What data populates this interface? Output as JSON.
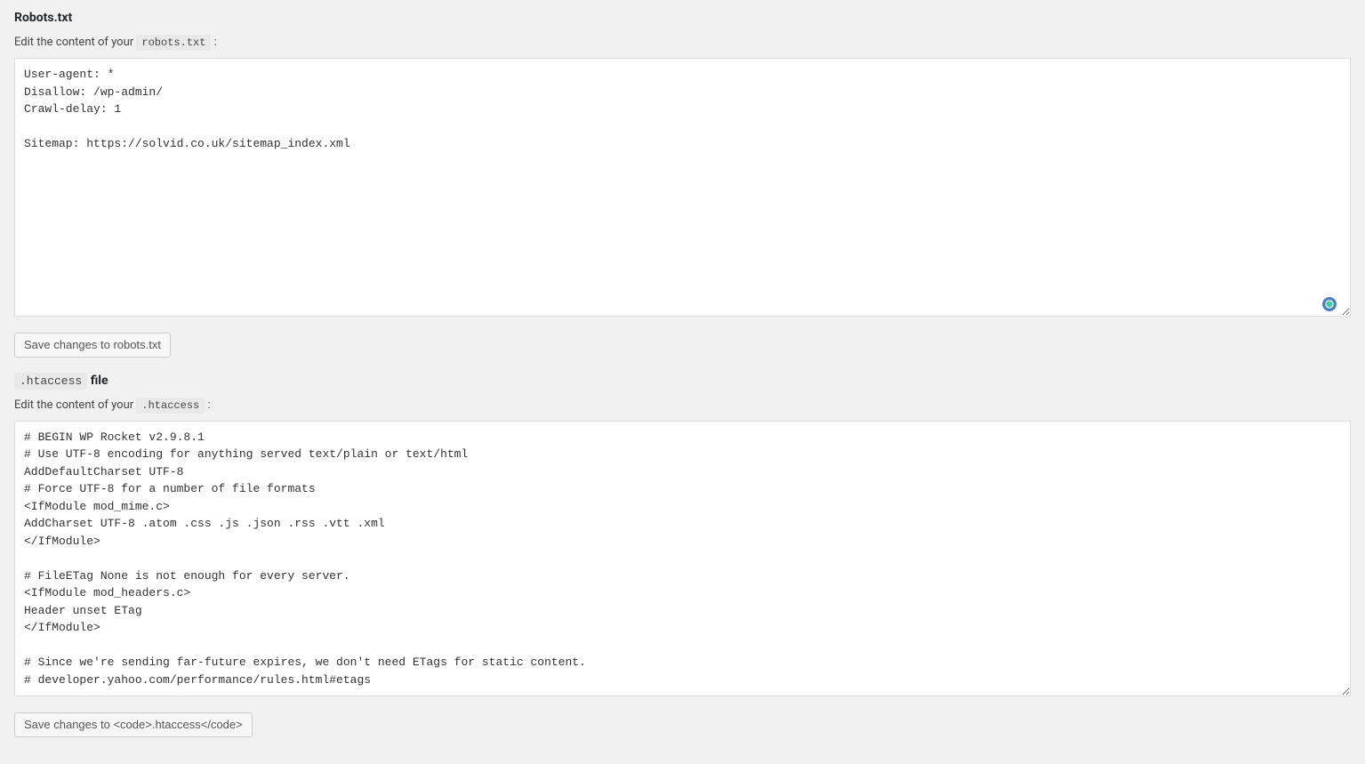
{
  "robots": {
    "title": "Robots.txt",
    "desc_prefix": "Edit the content of your ",
    "desc_code": "robots.txt",
    "desc_suffix": " :",
    "content": "User-agent: *\nDisallow: /wp-admin/\nCrawl-delay: 1\n\nSitemap: https://solvid.co.uk/sitemap_index.xml",
    "save_label": "Save changes to robots.txt"
  },
  "htaccess": {
    "title_code": ".htaccess",
    "title_suffix": " file",
    "desc_prefix": "Edit the content of your ",
    "desc_code": ".htaccess",
    "desc_suffix": " :",
    "content": "# BEGIN WP Rocket v2.9.8.1\n# Use UTF-8 encoding for anything served text/plain or text/html\nAddDefaultCharset UTF-8\n# Force UTF-8 for a number of file formats\n<IfModule mod_mime.c>\nAddCharset UTF-8 .atom .css .js .json .rss .vtt .xml\n</IfModule>\n\n# FileETag None is not enough for every server.\n<IfModule mod_headers.c>\nHeader unset ETag\n</IfModule>\n\n# Since we're sending far-future expires, we don't need ETags for static content.\n# developer.yahoo.com/performance/rules.html#etags",
    "save_label": "Save changes to <code>.htaccess</code>"
  }
}
